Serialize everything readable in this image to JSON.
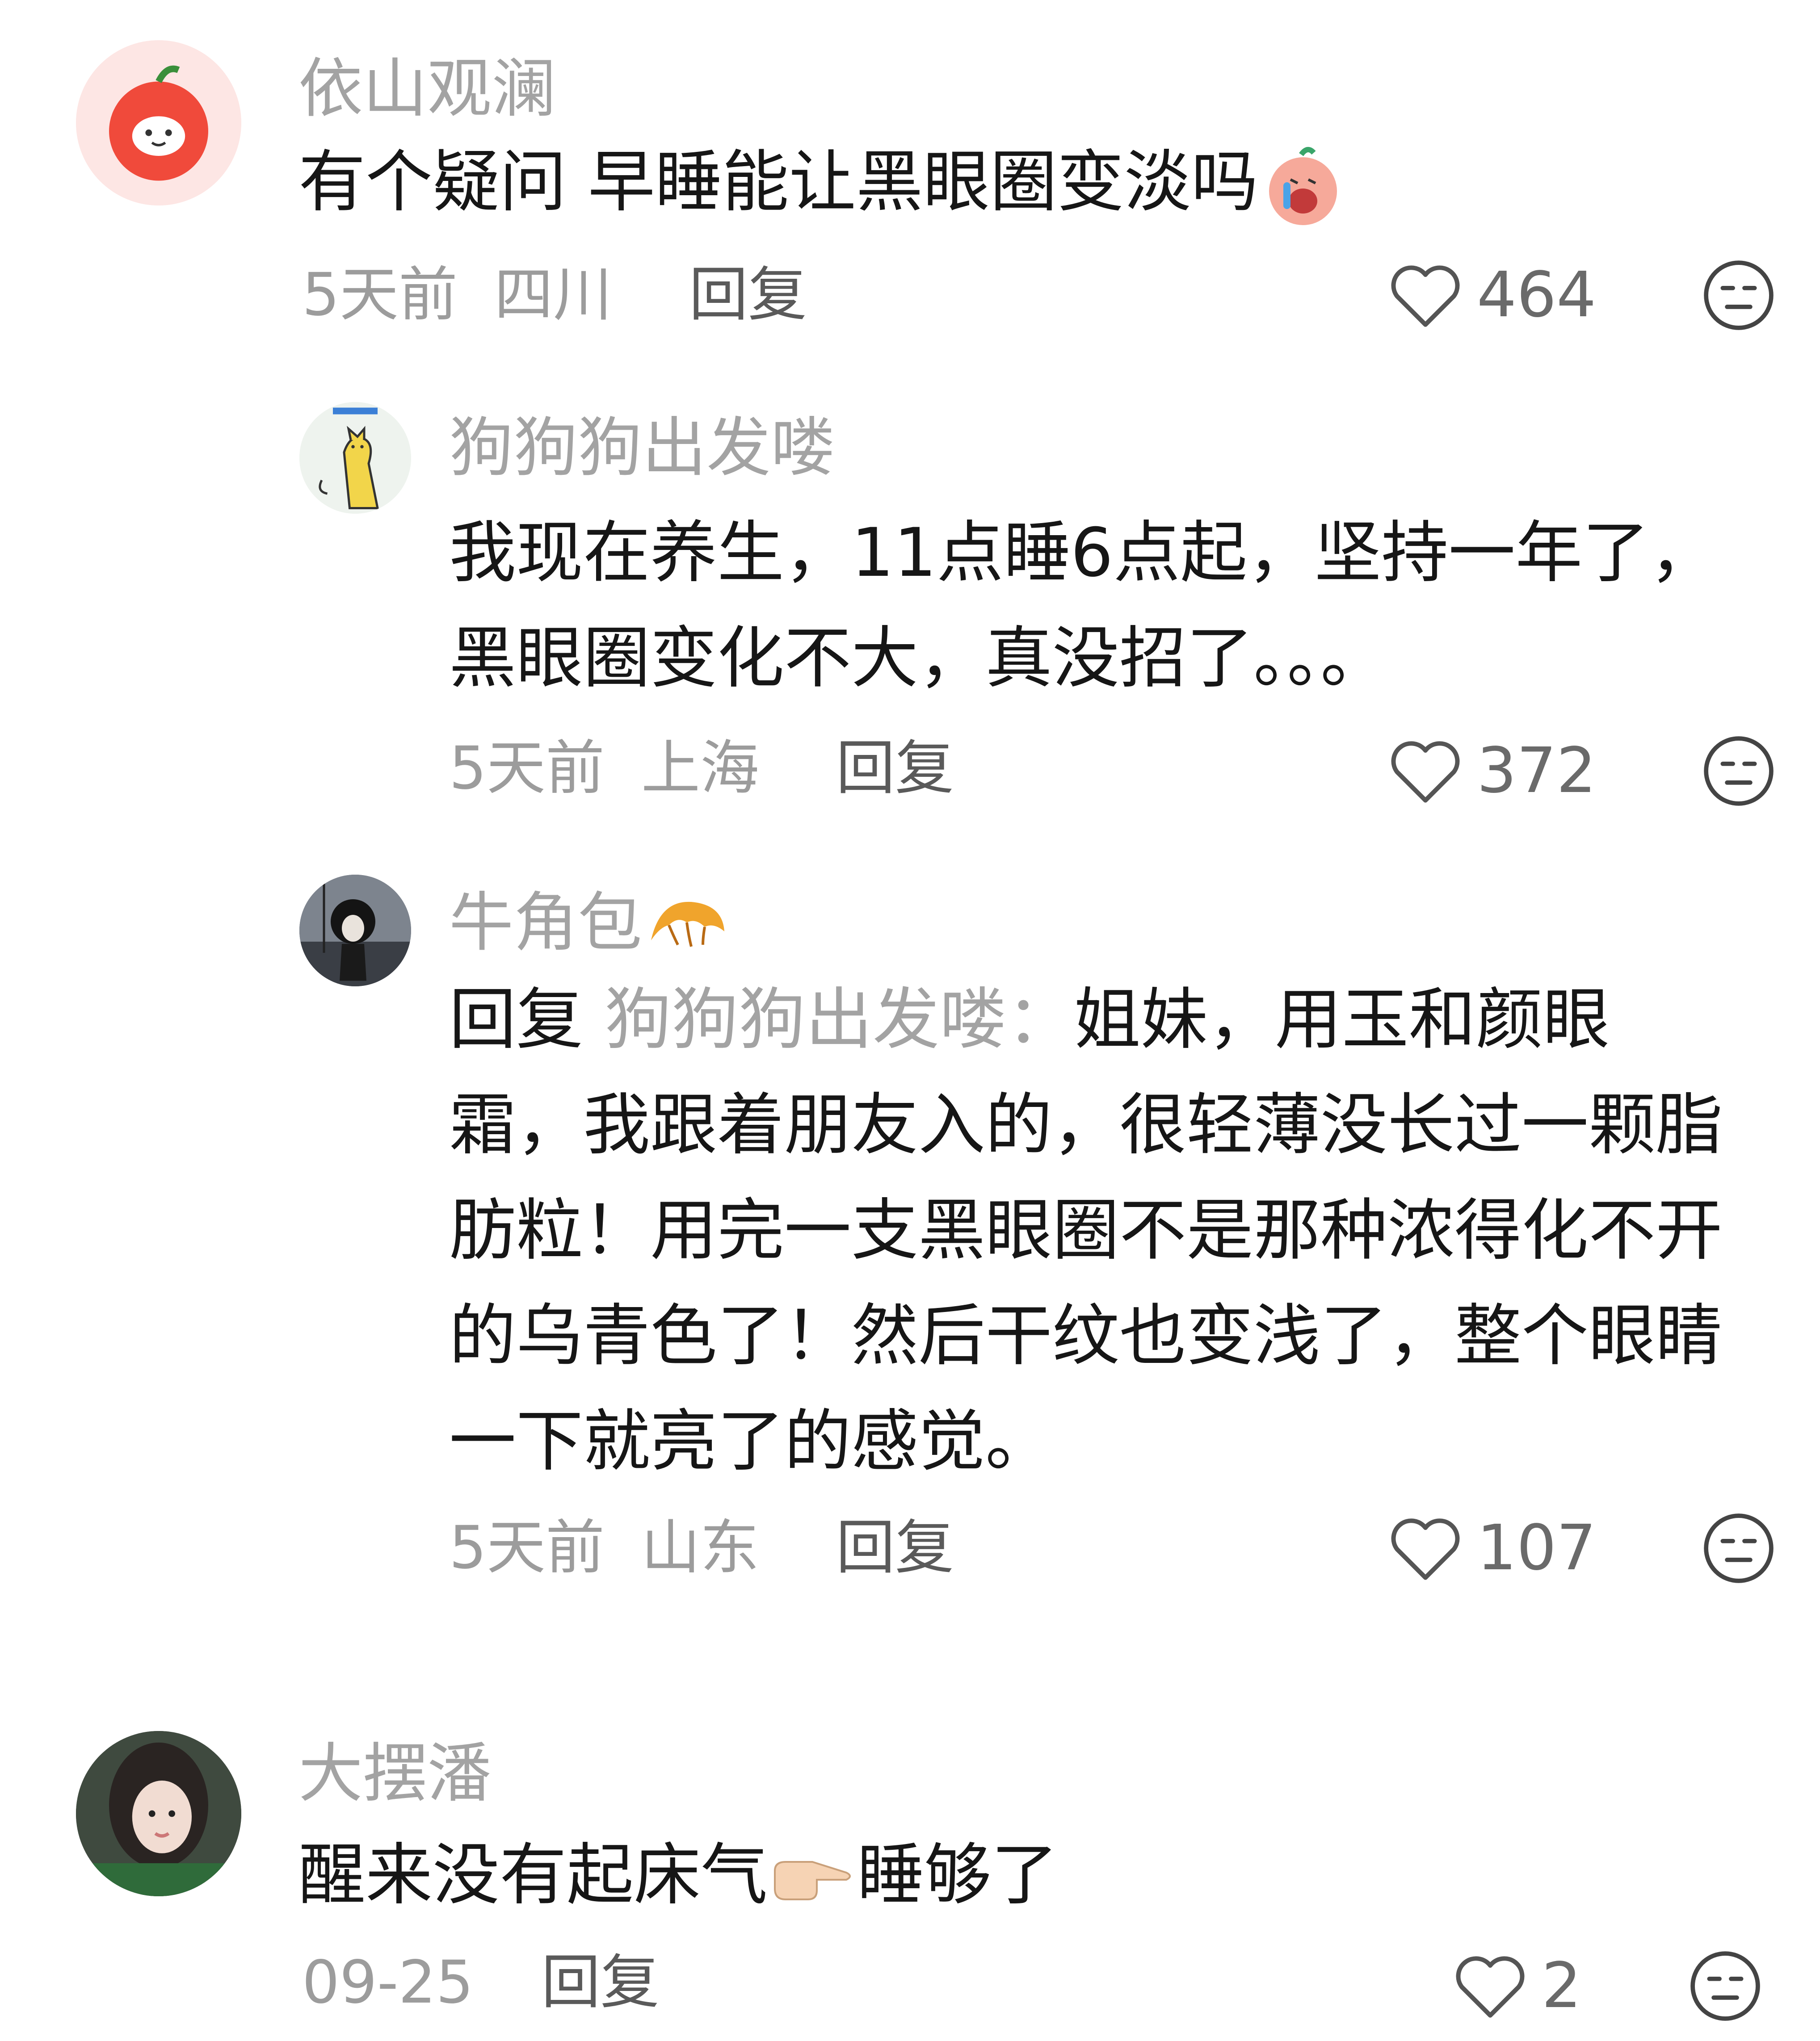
{
  "comments": [
    {
      "username": "依山观澜",
      "text": "有个疑问 早睡能让黑眼圈变淡吗",
      "emoji": "crying-face-emoji",
      "time": "5天前",
      "location": "四川",
      "reply_label": "回复",
      "likes": "464"
    },
    {
      "username": "狗狗狗出发喽",
      "text": "我现在养生，11点睡6点起，坚持一年了，黑眼圈变化不大，真没招了。。。",
      "time": "5天前",
      "location": "上海",
      "reply_label": "回复",
      "likes": "372"
    },
    {
      "username": "牛角包",
      "username_emoji": "croissant-emoji",
      "reply_prefix": "回复",
      "reply_target": "狗狗狗出发喽：",
      "text": "姐妹，用玉和颜眼霜，我跟着朋友入的，很轻薄没长过一颗脂肪粒！用完一支黑眼圈不是那种浓得化不开的乌青色了！然后干纹也变浅了，整个眼睛一下就亮了的感觉。",
      "time": "5天前",
      "location": "山东",
      "reply_label": "回复",
      "likes": "107"
    },
    {
      "username": "大摆潘",
      "text_before": "醒来没有起床气",
      "emoji": "pointing-right-emoji",
      "text_after": "睡够了",
      "time": "09-25",
      "reply_label": "回复",
      "likes": "2"
    }
  ],
  "icons": {
    "like": "heart-outline-icon",
    "dislike": "unamused-face-icon"
  },
  "colors": {
    "background": "#ffffff",
    "username": "#a3a3a3",
    "body": "#161616",
    "meta": "#9c9c9c",
    "reply_link": "#5a5a5a"
  }
}
